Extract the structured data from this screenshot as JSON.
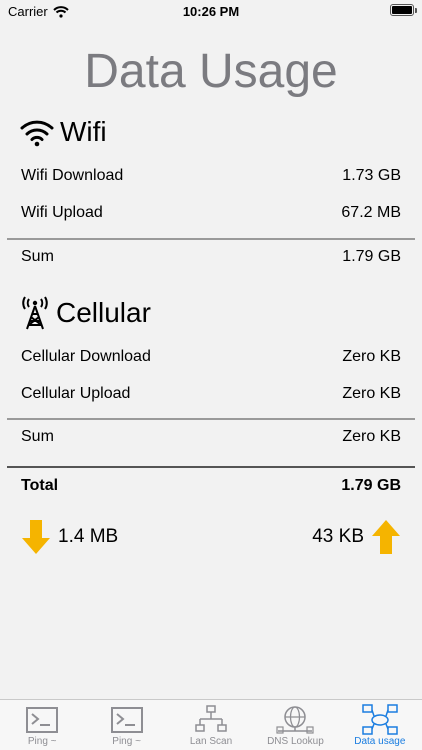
{
  "status_bar": {
    "carrier": "Carrier",
    "time": "10:26 PM"
  },
  "title": "Data Usage",
  "wifi": {
    "heading": "Wifi",
    "download_label": "Wifi Download",
    "download_value": "1.73 GB",
    "upload_label": "Wifi Upload",
    "upload_value": "67.2 MB",
    "sum_label": "Sum",
    "sum_value": "1.79 GB"
  },
  "cellular": {
    "heading": "Cellular",
    "download_label": "Cellular Download",
    "download_value": "Zero KB",
    "upload_label": "Cellular Upload",
    "upload_value": "Zero KB",
    "sum_label": "Sum",
    "sum_value": "Zero KB"
  },
  "total": {
    "label": "Total",
    "value": "1.79 GB"
  },
  "speed": {
    "download": "1.4 MB",
    "upload": "43 KB"
  },
  "colors": {
    "arrow": "#f5b400",
    "tab_active": "#1a7de0",
    "tab_inactive": "#8e8e93",
    "title": "#7b7b80"
  },
  "tabs": [
    {
      "label": "Ping ~",
      "icon": "terminal-icon",
      "active": false
    },
    {
      "label": "Ping ~",
      "icon": "terminal-icon",
      "active": false
    },
    {
      "label": "Lan Scan",
      "icon": "network-icon",
      "active": false
    },
    {
      "label": "DNS Lookup",
      "icon": "globe-network-icon",
      "active": false
    },
    {
      "label": "Data usage",
      "icon": "data-network-icon",
      "active": true
    }
  ]
}
